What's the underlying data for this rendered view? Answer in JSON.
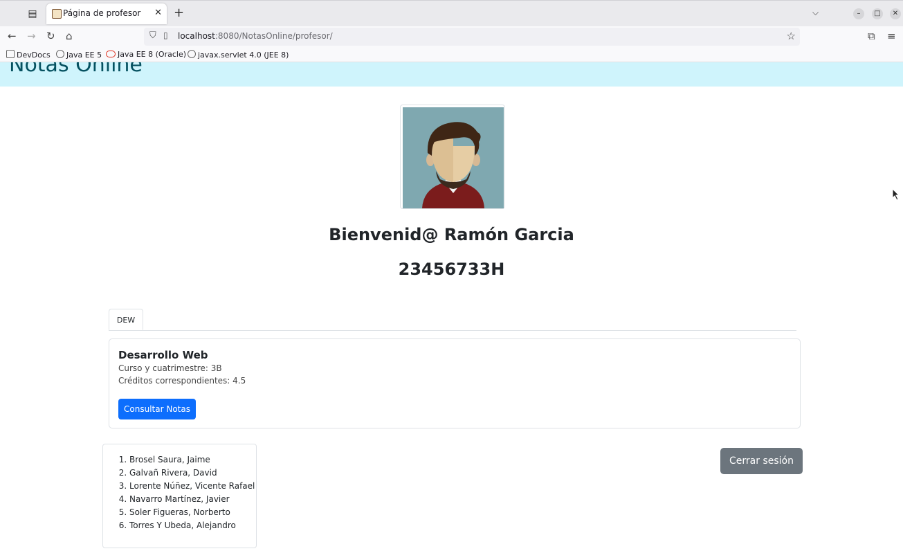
{
  "browser": {
    "tab_title": "Página de profesor",
    "url_host": "localhost",
    "url_rest": ":8080/NotasOnline/profesor/",
    "bookmarks": [
      "DevDocs",
      "Java EE 5",
      "Java EE 8 (Oracle)",
      "javax.servlet 4.0 (JEE 8)"
    ]
  },
  "page": {
    "site_title": "Notas Online",
    "welcome": "Bienvenid@ Ramón Garcia",
    "dni": "23456733H",
    "tabs": [
      "DEW"
    ],
    "course": {
      "title": "Desarrollo Web",
      "curso": "Curso y cuatrimestre: 3B",
      "creditos": "Créditos correspondientes: 4.5",
      "button": "Consultar Notas"
    },
    "students": [
      "Brosel Saura, Jaime",
      "Galvañ Rivera, David",
      "Lorente Núñez, Vicente Rafael",
      "Navarro Martínez, Javier",
      "Soler Figueras, Norberto",
      "Torres Y Ubeda, Alejandro"
    ],
    "logout": "Cerrar sesión"
  }
}
